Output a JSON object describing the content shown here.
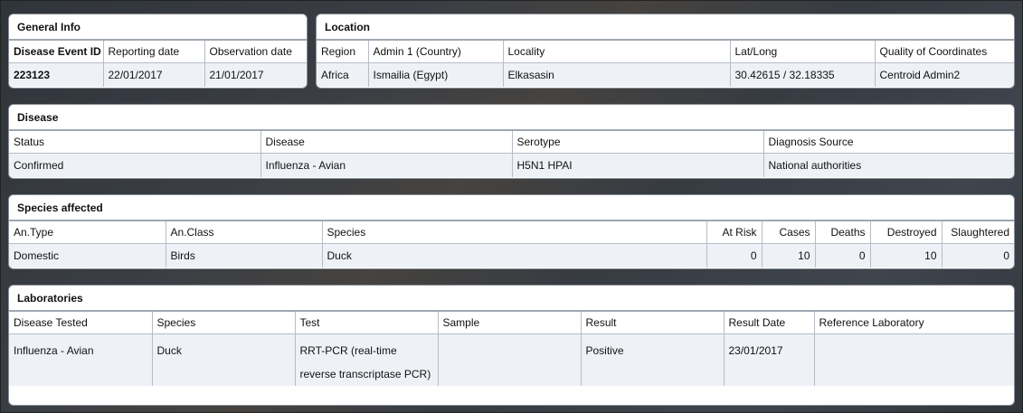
{
  "general_info": {
    "title": "General Info",
    "headers": [
      "Disease Event ID",
      "Reporting date",
      "Observation date"
    ],
    "values": [
      "223123",
      "22/01/2017",
      "21/01/2017"
    ]
  },
  "location": {
    "title": "Location",
    "headers": [
      "Region",
      "Admin 1 (Country)",
      "Locality",
      "Lat/Long",
      "Quality of Coordinates"
    ],
    "values": [
      "Africa",
      "Ismailia (Egypt)",
      "Elkasasin",
      "30.42615 / 32.18335",
      "Centroid Admin2"
    ]
  },
  "disease": {
    "title": "Disease",
    "headers": [
      "Status",
      "Disease",
      "Serotype",
      "Diagnosis Source"
    ],
    "values": [
      "Confirmed",
      "Influenza - Avian",
      "H5N1 HPAI",
      "National authorities"
    ]
  },
  "species": {
    "title": "Species affected",
    "headers": [
      "An.Type",
      "An.Class",
      "Species",
      "At Risk",
      "Cases",
      "Deaths",
      "Destroyed",
      "Slaughtered"
    ],
    "values": [
      "Domestic",
      "Birds",
      "Duck",
      "0",
      "10",
      "0",
      "10",
      "0"
    ]
  },
  "laboratories": {
    "title": "Laboratories",
    "headers": [
      "Disease Tested",
      "Species",
      "Test",
      "Sample",
      "Result",
      "Result Date",
      "Reference Laboratory"
    ],
    "values": [
      "Influenza - Avian",
      "Duck",
      "RRT-PCR (real-time reverse transcriptase PCR)",
      "",
      "Positive",
      "23/01/2017",
      ""
    ]
  }
}
